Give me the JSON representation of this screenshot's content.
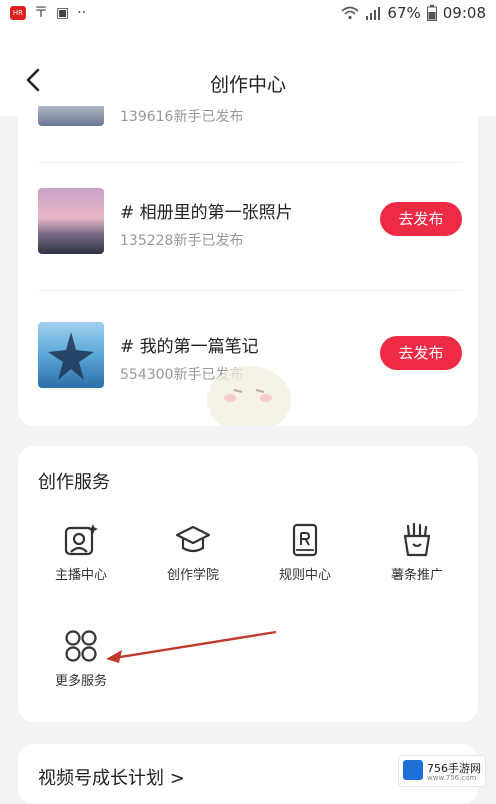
{
  "status_bar": {
    "battery": "67%",
    "time": "09:08",
    "app_badge": "HR"
  },
  "header": {
    "title": "创作中心"
  },
  "tasks": [
    {
      "title": "",
      "subtitle": "139616新手已发布"
    },
    {
      "title": "# 相册里的第一张照片",
      "subtitle": "135228新手已发布",
      "button": "去发布"
    },
    {
      "title": "# 我的第一篇笔记",
      "subtitle": "554300新手已发布",
      "button": "去发布"
    }
  ],
  "services": {
    "title": "创作服务",
    "items": [
      {
        "label": "主播中心",
        "icon": "streamer-icon"
      },
      {
        "label": "创作学院",
        "icon": "graduation-cap-icon"
      },
      {
        "label": "规则中心",
        "icon": "rule-book-icon"
      },
      {
        "label": "薯条推广",
        "icon": "fries-icon"
      },
      {
        "label": "更多服务",
        "icon": "more-grid-icon"
      }
    ]
  },
  "growth": {
    "label": "视频号成长计划 >"
  },
  "watermark": {
    "text": "756手游网",
    "sub": "www.756.com"
  }
}
